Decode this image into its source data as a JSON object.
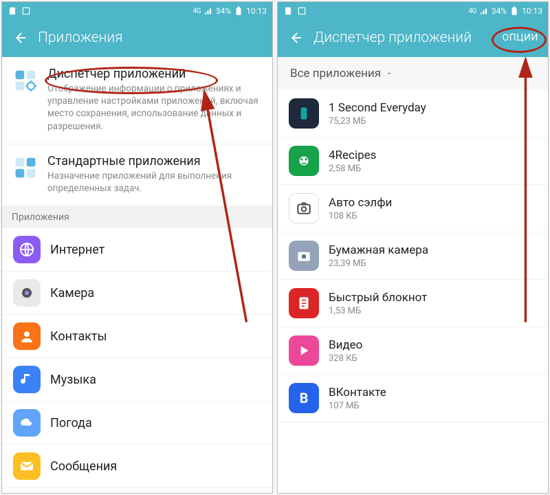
{
  "status": {
    "network_label": "4G",
    "battery_text": "34%",
    "time": "10:13"
  },
  "left": {
    "title": "Приложения",
    "app_manager": {
      "title": "Диспетчер приложений",
      "desc": "Отображение информации о приложениях и управление настройками приложений, включая место сохранения, использование данных и разрешения."
    },
    "default_apps": {
      "title": "Стандартные приложения",
      "desc": "Назначение приложений для выполнения определенных задач."
    },
    "section": "Приложения",
    "apps": [
      {
        "name": "Интернет",
        "bg": "#8b5cf6"
      },
      {
        "name": "Камера",
        "bg": "#e9e9e9"
      },
      {
        "name": "Контакты",
        "bg": "#f97316"
      },
      {
        "name": "Музыка",
        "bg": "#3b82f6"
      },
      {
        "name": "Погода",
        "bg": "#60a5fa"
      },
      {
        "name": "Сообщения",
        "bg": "#fbbf24"
      }
    ]
  },
  "right": {
    "title": "Диспетчер приложений",
    "options": "ОПЦИИ",
    "filter": "Все приложения",
    "apps": [
      {
        "name": "1 Second Everyday",
        "size": "75,23 МБ",
        "bg": "#1e293b"
      },
      {
        "name": "4Recipes",
        "size": "2,58 МБ",
        "bg": "#16a34a"
      },
      {
        "name": "Авто сэлфи",
        "size": "108 КБ",
        "bg": "#ffffff"
      },
      {
        "name": "Бумажная камера",
        "size": "23,39 МБ",
        "bg": "#94a3b8"
      },
      {
        "name": "Быстрый блокнот",
        "size": "1,53 МБ",
        "bg": "#dc2626"
      },
      {
        "name": "Видео",
        "size": "328 КБ",
        "bg": "#ec4899"
      },
      {
        "name": "ВКонтакте",
        "size": "107 МБ",
        "bg": "#2563eb"
      }
    ]
  }
}
